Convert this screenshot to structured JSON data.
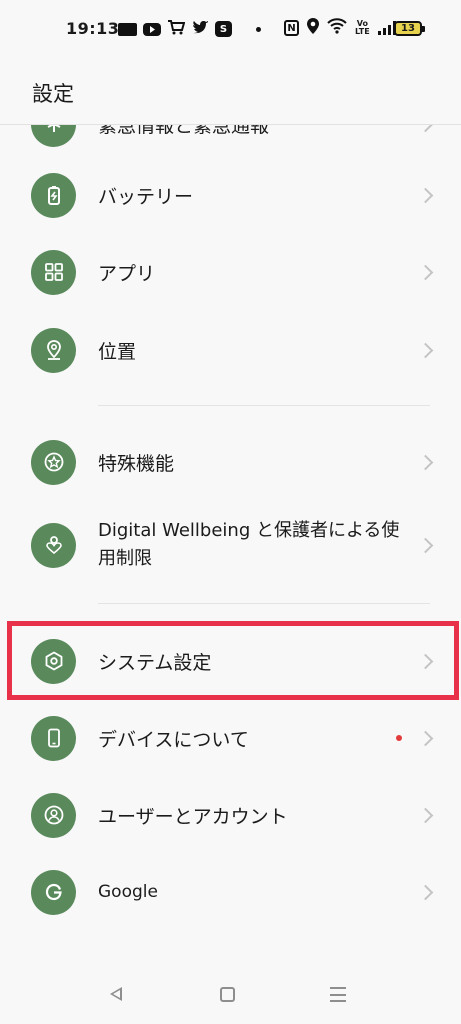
{
  "status_bar": {
    "time": "19:13",
    "battery": "13",
    "left_icons": [
      "news-icon",
      "youtube-icon",
      "cart-icon",
      "twitter-icon",
      "s-app-icon",
      "more-dot-icon"
    ],
    "s_app_glyph": "S",
    "right_icons": [
      "nfc-icon",
      "location-icon",
      "wifi-icon",
      "volte-icon",
      "signal-icon",
      "battery-icon"
    ],
    "nfc_glyph": "N",
    "volte_top": "Vo",
    "volte_bottom": "LTE"
  },
  "header": {
    "title": "設定"
  },
  "settings": [
    {
      "key": "emergency",
      "label": "緊急情報と緊急通報",
      "icon": "emergency-icon",
      "partial": true
    },
    {
      "key": "battery",
      "label": "バッテリー",
      "icon": "battery-icon"
    },
    {
      "key": "apps",
      "label": "アプリ",
      "icon": "apps-grid-icon"
    },
    {
      "key": "location",
      "label": "位置",
      "icon": "location-pin-icon"
    },
    {
      "key": "accessibility",
      "label": "特殊機能",
      "icon": "star-circle-icon"
    },
    {
      "key": "wellbeing",
      "label": "Digital Wellbeing と保護者による使用制限",
      "icon": "heart-person-icon"
    },
    {
      "key": "system",
      "label": "システム設定",
      "icon": "hexagon-gear-icon",
      "highlighted": true
    },
    {
      "key": "about",
      "label": "デバイスについて",
      "icon": "phone-device-icon",
      "badge": "red-dot"
    },
    {
      "key": "accounts",
      "label": "ユーザーとアカウント",
      "icon": "user-circle-icon"
    },
    {
      "key": "google",
      "label": "Google",
      "icon": "google-g-icon"
    }
  ],
  "colors": {
    "accent_green": "#5a8a5c",
    "highlight_red": "#e8324a",
    "badge_red": "#e23b3b",
    "background": "#f8f8f8"
  },
  "nav_bar": [
    "back-icon",
    "home-icon",
    "recents-icon"
  ]
}
